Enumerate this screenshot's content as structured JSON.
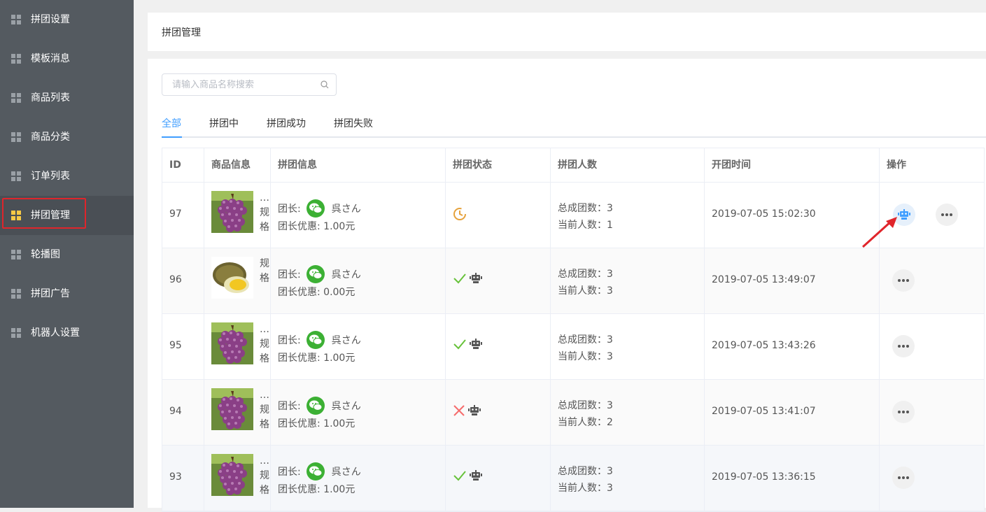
{
  "sidebar": {
    "items": [
      {
        "label": "拼团设置"
      },
      {
        "label": "模板消息"
      },
      {
        "label": "商品列表"
      },
      {
        "label": "商品分类"
      },
      {
        "label": "订单列表"
      },
      {
        "label": "拼团管理",
        "active": true
      },
      {
        "label": "轮播图"
      },
      {
        "label": "拼团广告"
      },
      {
        "label": "机器人设置"
      }
    ]
  },
  "header": {
    "title": "拼团管理"
  },
  "search": {
    "placeholder": "请输入商品名称搜索",
    "value": ""
  },
  "tabs": [
    {
      "label": "全部",
      "active": true
    },
    {
      "label": "拼团中"
    },
    {
      "label": "拼团成功"
    },
    {
      "label": "拼团失败"
    }
  ],
  "table": {
    "columns": [
      "ID",
      "商品信息",
      "拼团信息",
      "拼团状态",
      "拼团人数",
      "开团时间",
      "操作"
    ],
    "rows": [
      {
        "id": "97",
        "product_text": "…规格",
        "leader_label": "团长:",
        "leader_name": "呉さん",
        "discount": "团长优惠: 1.00元",
        "status": "in-progress",
        "total": "总成团数：3",
        "current": "当前人数：1",
        "time": "2019-07-05 15:02:30",
        "image": "grape"
      },
      {
        "id": "96",
        "product_text": "规格",
        "leader_label": "团长:",
        "leader_name": "呉さん",
        "discount": "团长优惠: 0.00元",
        "status": "success",
        "total": "总成团数：3",
        "current": "当前人数：3",
        "time": "2019-07-05 13:49:07",
        "image": "durian"
      },
      {
        "id": "95",
        "product_text": "…规格",
        "leader_label": "团长:",
        "leader_name": "呉さん",
        "discount": "团长优惠: 1.00元",
        "status": "success",
        "total": "总成团数：3",
        "current": "当前人数：3",
        "time": "2019-07-05 13:43:26",
        "image": "grape"
      },
      {
        "id": "94",
        "product_text": "…规格",
        "leader_label": "团长:",
        "leader_name": "呉さん",
        "discount": "团长优惠: 1.00元",
        "status": "failed",
        "total": "总成团数：3",
        "current": "当前人数：2",
        "time": "2019-07-05 13:41:07",
        "image": "grape"
      },
      {
        "id": "93",
        "product_text": "…规格",
        "leader_label": "团长:",
        "leader_name": "呉さん",
        "discount": "团长优惠: 1.00元",
        "status": "success",
        "total": "总成团数：3",
        "current": "当前人数：3",
        "time": "2019-07-05 13:36:15",
        "image": "grape"
      }
    ]
  },
  "colors": {
    "accent": "#409eff",
    "sidebar_bg": "#545a60",
    "active_icon": "#f6c945",
    "success": "#67c23a",
    "failed": "#f56c6c",
    "pending": "#e6a23c",
    "highlight": "#e0252b"
  },
  "icons": {
    "sidebar": "grid-icon",
    "search": "search-icon",
    "wechat": "wechat-icon",
    "robot": "robot-icon",
    "more": "more-icon",
    "clock": "clock-icon",
    "check": "check-icon",
    "cross": "cross-icon"
  }
}
